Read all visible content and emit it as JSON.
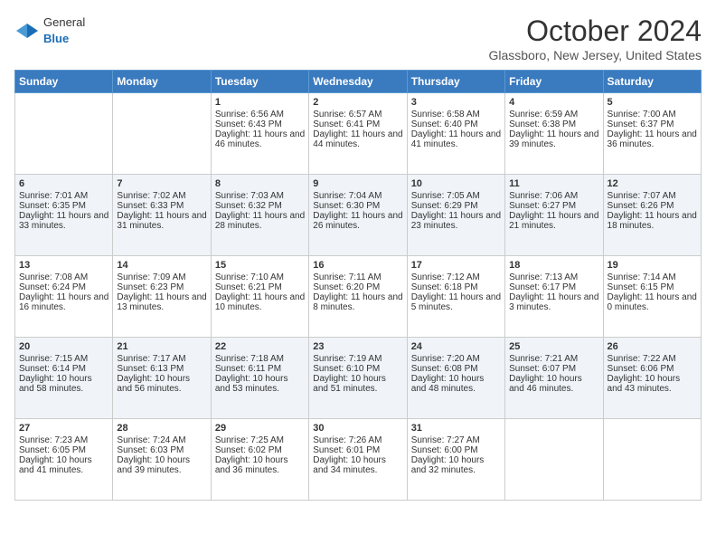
{
  "header": {
    "logo": {
      "general": "General",
      "blue": "Blue"
    },
    "title": "October 2024",
    "location": "Glassboro, New Jersey, United States"
  },
  "days_of_week": [
    "Sunday",
    "Monday",
    "Tuesday",
    "Wednesday",
    "Thursday",
    "Friday",
    "Saturday"
  ],
  "weeks": [
    [
      {
        "day": "",
        "data": []
      },
      {
        "day": "",
        "data": []
      },
      {
        "day": "1",
        "data": [
          "Sunrise: 6:56 AM",
          "Sunset: 6:43 PM",
          "Daylight: 11 hours and 46 minutes."
        ]
      },
      {
        "day": "2",
        "data": [
          "Sunrise: 6:57 AM",
          "Sunset: 6:41 PM",
          "Daylight: 11 hours and 44 minutes."
        ]
      },
      {
        "day": "3",
        "data": [
          "Sunrise: 6:58 AM",
          "Sunset: 6:40 PM",
          "Daylight: 11 hours and 41 minutes."
        ]
      },
      {
        "day": "4",
        "data": [
          "Sunrise: 6:59 AM",
          "Sunset: 6:38 PM",
          "Daylight: 11 hours and 39 minutes."
        ]
      },
      {
        "day": "5",
        "data": [
          "Sunrise: 7:00 AM",
          "Sunset: 6:37 PM",
          "Daylight: 11 hours and 36 minutes."
        ]
      }
    ],
    [
      {
        "day": "6",
        "data": [
          "Sunrise: 7:01 AM",
          "Sunset: 6:35 PM",
          "Daylight: 11 hours and 33 minutes."
        ]
      },
      {
        "day": "7",
        "data": [
          "Sunrise: 7:02 AM",
          "Sunset: 6:33 PM",
          "Daylight: 11 hours and 31 minutes."
        ]
      },
      {
        "day": "8",
        "data": [
          "Sunrise: 7:03 AM",
          "Sunset: 6:32 PM",
          "Daylight: 11 hours and 28 minutes."
        ]
      },
      {
        "day": "9",
        "data": [
          "Sunrise: 7:04 AM",
          "Sunset: 6:30 PM",
          "Daylight: 11 hours and 26 minutes."
        ]
      },
      {
        "day": "10",
        "data": [
          "Sunrise: 7:05 AM",
          "Sunset: 6:29 PM",
          "Daylight: 11 hours and 23 minutes."
        ]
      },
      {
        "day": "11",
        "data": [
          "Sunrise: 7:06 AM",
          "Sunset: 6:27 PM",
          "Daylight: 11 hours and 21 minutes."
        ]
      },
      {
        "day": "12",
        "data": [
          "Sunrise: 7:07 AM",
          "Sunset: 6:26 PM",
          "Daylight: 11 hours and 18 minutes."
        ]
      }
    ],
    [
      {
        "day": "13",
        "data": [
          "Sunrise: 7:08 AM",
          "Sunset: 6:24 PM",
          "Daylight: 11 hours and 16 minutes."
        ]
      },
      {
        "day": "14",
        "data": [
          "Sunrise: 7:09 AM",
          "Sunset: 6:23 PM",
          "Daylight: 11 hours and 13 minutes."
        ]
      },
      {
        "day": "15",
        "data": [
          "Sunrise: 7:10 AM",
          "Sunset: 6:21 PM",
          "Daylight: 11 hours and 10 minutes."
        ]
      },
      {
        "day": "16",
        "data": [
          "Sunrise: 7:11 AM",
          "Sunset: 6:20 PM",
          "Daylight: 11 hours and 8 minutes."
        ]
      },
      {
        "day": "17",
        "data": [
          "Sunrise: 7:12 AM",
          "Sunset: 6:18 PM",
          "Daylight: 11 hours and 5 minutes."
        ]
      },
      {
        "day": "18",
        "data": [
          "Sunrise: 7:13 AM",
          "Sunset: 6:17 PM",
          "Daylight: 11 hours and 3 minutes."
        ]
      },
      {
        "day": "19",
        "data": [
          "Sunrise: 7:14 AM",
          "Sunset: 6:15 PM",
          "Daylight: 11 hours and 0 minutes."
        ]
      }
    ],
    [
      {
        "day": "20",
        "data": [
          "Sunrise: 7:15 AM",
          "Sunset: 6:14 PM",
          "Daylight: 10 hours and 58 minutes."
        ]
      },
      {
        "day": "21",
        "data": [
          "Sunrise: 7:17 AM",
          "Sunset: 6:13 PM",
          "Daylight: 10 hours and 56 minutes."
        ]
      },
      {
        "day": "22",
        "data": [
          "Sunrise: 7:18 AM",
          "Sunset: 6:11 PM",
          "Daylight: 10 hours and 53 minutes."
        ]
      },
      {
        "day": "23",
        "data": [
          "Sunrise: 7:19 AM",
          "Sunset: 6:10 PM",
          "Daylight: 10 hours and 51 minutes."
        ]
      },
      {
        "day": "24",
        "data": [
          "Sunrise: 7:20 AM",
          "Sunset: 6:08 PM",
          "Daylight: 10 hours and 48 minutes."
        ]
      },
      {
        "day": "25",
        "data": [
          "Sunrise: 7:21 AM",
          "Sunset: 6:07 PM",
          "Daylight: 10 hours and 46 minutes."
        ]
      },
      {
        "day": "26",
        "data": [
          "Sunrise: 7:22 AM",
          "Sunset: 6:06 PM",
          "Daylight: 10 hours and 43 minutes."
        ]
      }
    ],
    [
      {
        "day": "27",
        "data": [
          "Sunrise: 7:23 AM",
          "Sunset: 6:05 PM",
          "Daylight: 10 hours and 41 minutes."
        ]
      },
      {
        "day": "28",
        "data": [
          "Sunrise: 7:24 AM",
          "Sunset: 6:03 PM",
          "Daylight: 10 hours and 39 minutes."
        ]
      },
      {
        "day": "29",
        "data": [
          "Sunrise: 7:25 AM",
          "Sunset: 6:02 PM",
          "Daylight: 10 hours and 36 minutes."
        ]
      },
      {
        "day": "30",
        "data": [
          "Sunrise: 7:26 AM",
          "Sunset: 6:01 PM",
          "Daylight: 10 hours and 34 minutes."
        ]
      },
      {
        "day": "31",
        "data": [
          "Sunrise: 7:27 AM",
          "Sunset: 6:00 PM",
          "Daylight: 10 hours and 32 minutes."
        ]
      },
      {
        "day": "",
        "data": []
      },
      {
        "day": "",
        "data": []
      }
    ]
  ]
}
